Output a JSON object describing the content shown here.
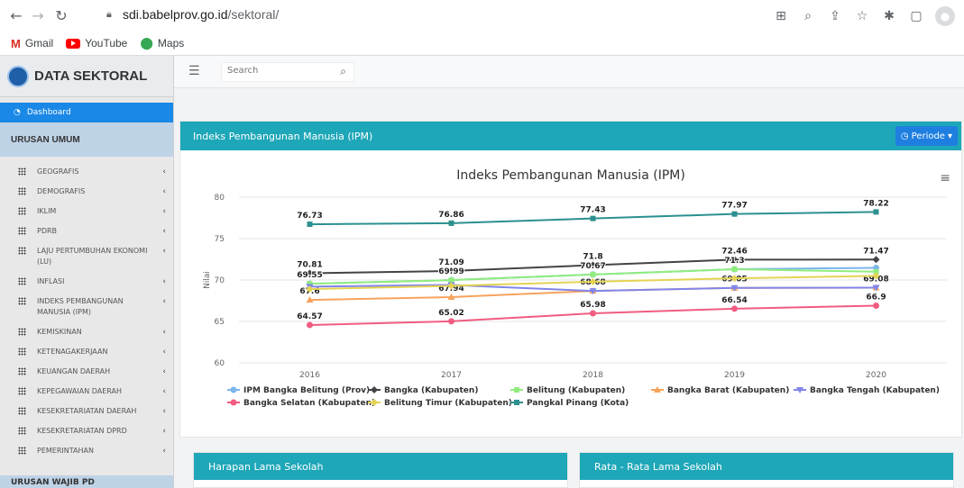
{
  "browser": {
    "url_domain": "sdi.babelprov.go.id",
    "url_path": "/sektoral/",
    "bookmarks": [
      {
        "label": "Gmail",
        "icon": "gmail-icon"
      },
      {
        "label": "YouTube",
        "icon": "youtube-icon"
      },
      {
        "label": "Maps",
        "icon": "maps-icon"
      }
    ]
  },
  "sidebar": {
    "brand": "DATA SEKTORAL",
    "dashboard": "Dashboard",
    "section": "URUSAN UMUM",
    "items": [
      {
        "label": "GEOGRAFIS"
      },
      {
        "label": "DEMOGRAFIS"
      },
      {
        "label": "IKLIM"
      },
      {
        "label": "PDRB"
      },
      {
        "label": "LAJU PERTUMBUHAN EKONOMI (LU)"
      },
      {
        "label": "INFLASI"
      },
      {
        "label": "INDEKS PEMBANGUNAN MANUSIA (IPM)"
      },
      {
        "label": "KEMISKINAN"
      },
      {
        "label": "KETENAGAKERJAAN"
      },
      {
        "label": "KEUANGAN DAERAH"
      },
      {
        "label": "KEPEGAWAIAN DAERAH"
      },
      {
        "label": "KESEKRETARIATAN DAERAH"
      },
      {
        "label": "KESEKRETARIATAN DPRD"
      },
      {
        "label": "PEMERINTAHAN"
      }
    ],
    "section2": "URUSAN WAJIB PD"
  },
  "topbar": {
    "search_placeholder": "Search"
  },
  "card": {
    "title": "Indeks Pembangunan Manusia (IPM)",
    "periode_label": "Periode"
  },
  "subcards": {
    "left_title": "Harapan Lama Sekolah",
    "right_title": "Rata - Rata Lama Sekolah"
  },
  "chart_data": {
    "type": "line",
    "title": "Indeks Pembangunan Manusia (IPM)",
    "xlabel": "",
    "ylabel": "Nilai",
    "ylim": [
      60,
      80
    ],
    "yticks": [
      60,
      65,
      70,
      75,
      80
    ],
    "categories": [
      "2016",
      "2017",
      "2018",
      "2019",
      "2020"
    ],
    "legend_position": "bottom",
    "series": [
      {
        "name": "IPM Bangka Belitung (Prov)",
        "color": "#7cb5ec",
        "marker": "circle",
        "values": [
          69.55,
          69.99,
          70.67,
          71.3,
          71.47
        ],
        "labels": [
          false,
          false,
          false,
          false,
          false
        ]
      },
      {
        "name": "Bangka (Kabupaten)",
        "color": "#434348",
        "marker": "diamond",
        "values": [
          70.81,
          71.09,
          71.8,
          72.46,
          72.47
        ],
        "labels": [
          true,
          true,
          true,
          true,
          true
        ],
        "label_texts": [
          "70.81",
          "71.09",
          "71.8",
          "72.46",
          "71.47"
        ]
      },
      {
        "name": "Belitung (Kabupaten)",
        "color": "#90ed7d",
        "marker": "square",
        "values": [
          69.55,
          69.99,
          70.67,
          71.3,
          71.0
        ],
        "labels": [
          true,
          true,
          true,
          true,
          false
        ],
        "label_texts": [
          "69.55",
          "69.99",
          "70.67",
          "71.3",
          ""
        ]
      },
      {
        "name": "Bangka Barat (Kabupaten)",
        "color": "#f7a35c",
        "marker": "triangle",
        "values": [
          67.6,
          67.94,
          68.68,
          69.05,
          69.08
        ],
        "labels": [
          true,
          true,
          false,
          false,
          false
        ],
        "label_texts": [
          "67.6",
          "67.94",
          "",
          "",
          ""
        ]
      },
      {
        "name": "Bangka Tengah (Kabupaten)",
        "color": "#8085e9",
        "marker": "triangle-down",
        "values": [
          69.2,
          69.4,
          68.68,
          69.05,
          69.08
        ],
        "labels": [
          false,
          false,
          true,
          true,
          true
        ],
        "label_texts": [
          "",
          "",
          "68.68",
          "69.05",
          "69.08"
        ]
      },
      {
        "name": "Bangka Selatan (Kabupaten)",
        "color": "#f15c80",
        "marker": "circle",
        "values": [
          64.57,
          65.02,
          65.98,
          66.54,
          66.9
        ],
        "labels": [
          true,
          true,
          true,
          true,
          true
        ],
        "label_texts": [
          "64.57",
          "65.02",
          "65.98",
          "66.54",
          "66.9"
        ]
      },
      {
        "name": "Belitung Timur (Kabupaten)",
        "color": "#e4d354",
        "marker": "diamond",
        "values": [
          68.9,
          69.3,
          69.8,
          70.2,
          70.5
        ],
        "labels": [
          false,
          false,
          false,
          false,
          false
        ]
      },
      {
        "name": "Pangkal Pinang (Kota)",
        "color": "#2b908f",
        "marker": "square",
        "values": [
          76.73,
          76.86,
          77.43,
          77.97,
          78.22
        ],
        "labels": [
          true,
          true,
          true,
          true,
          true
        ],
        "label_texts": [
          "76.73",
          "76.86",
          "77.43",
          "77.97",
          "78.22"
        ]
      }
    ]
  }
}
